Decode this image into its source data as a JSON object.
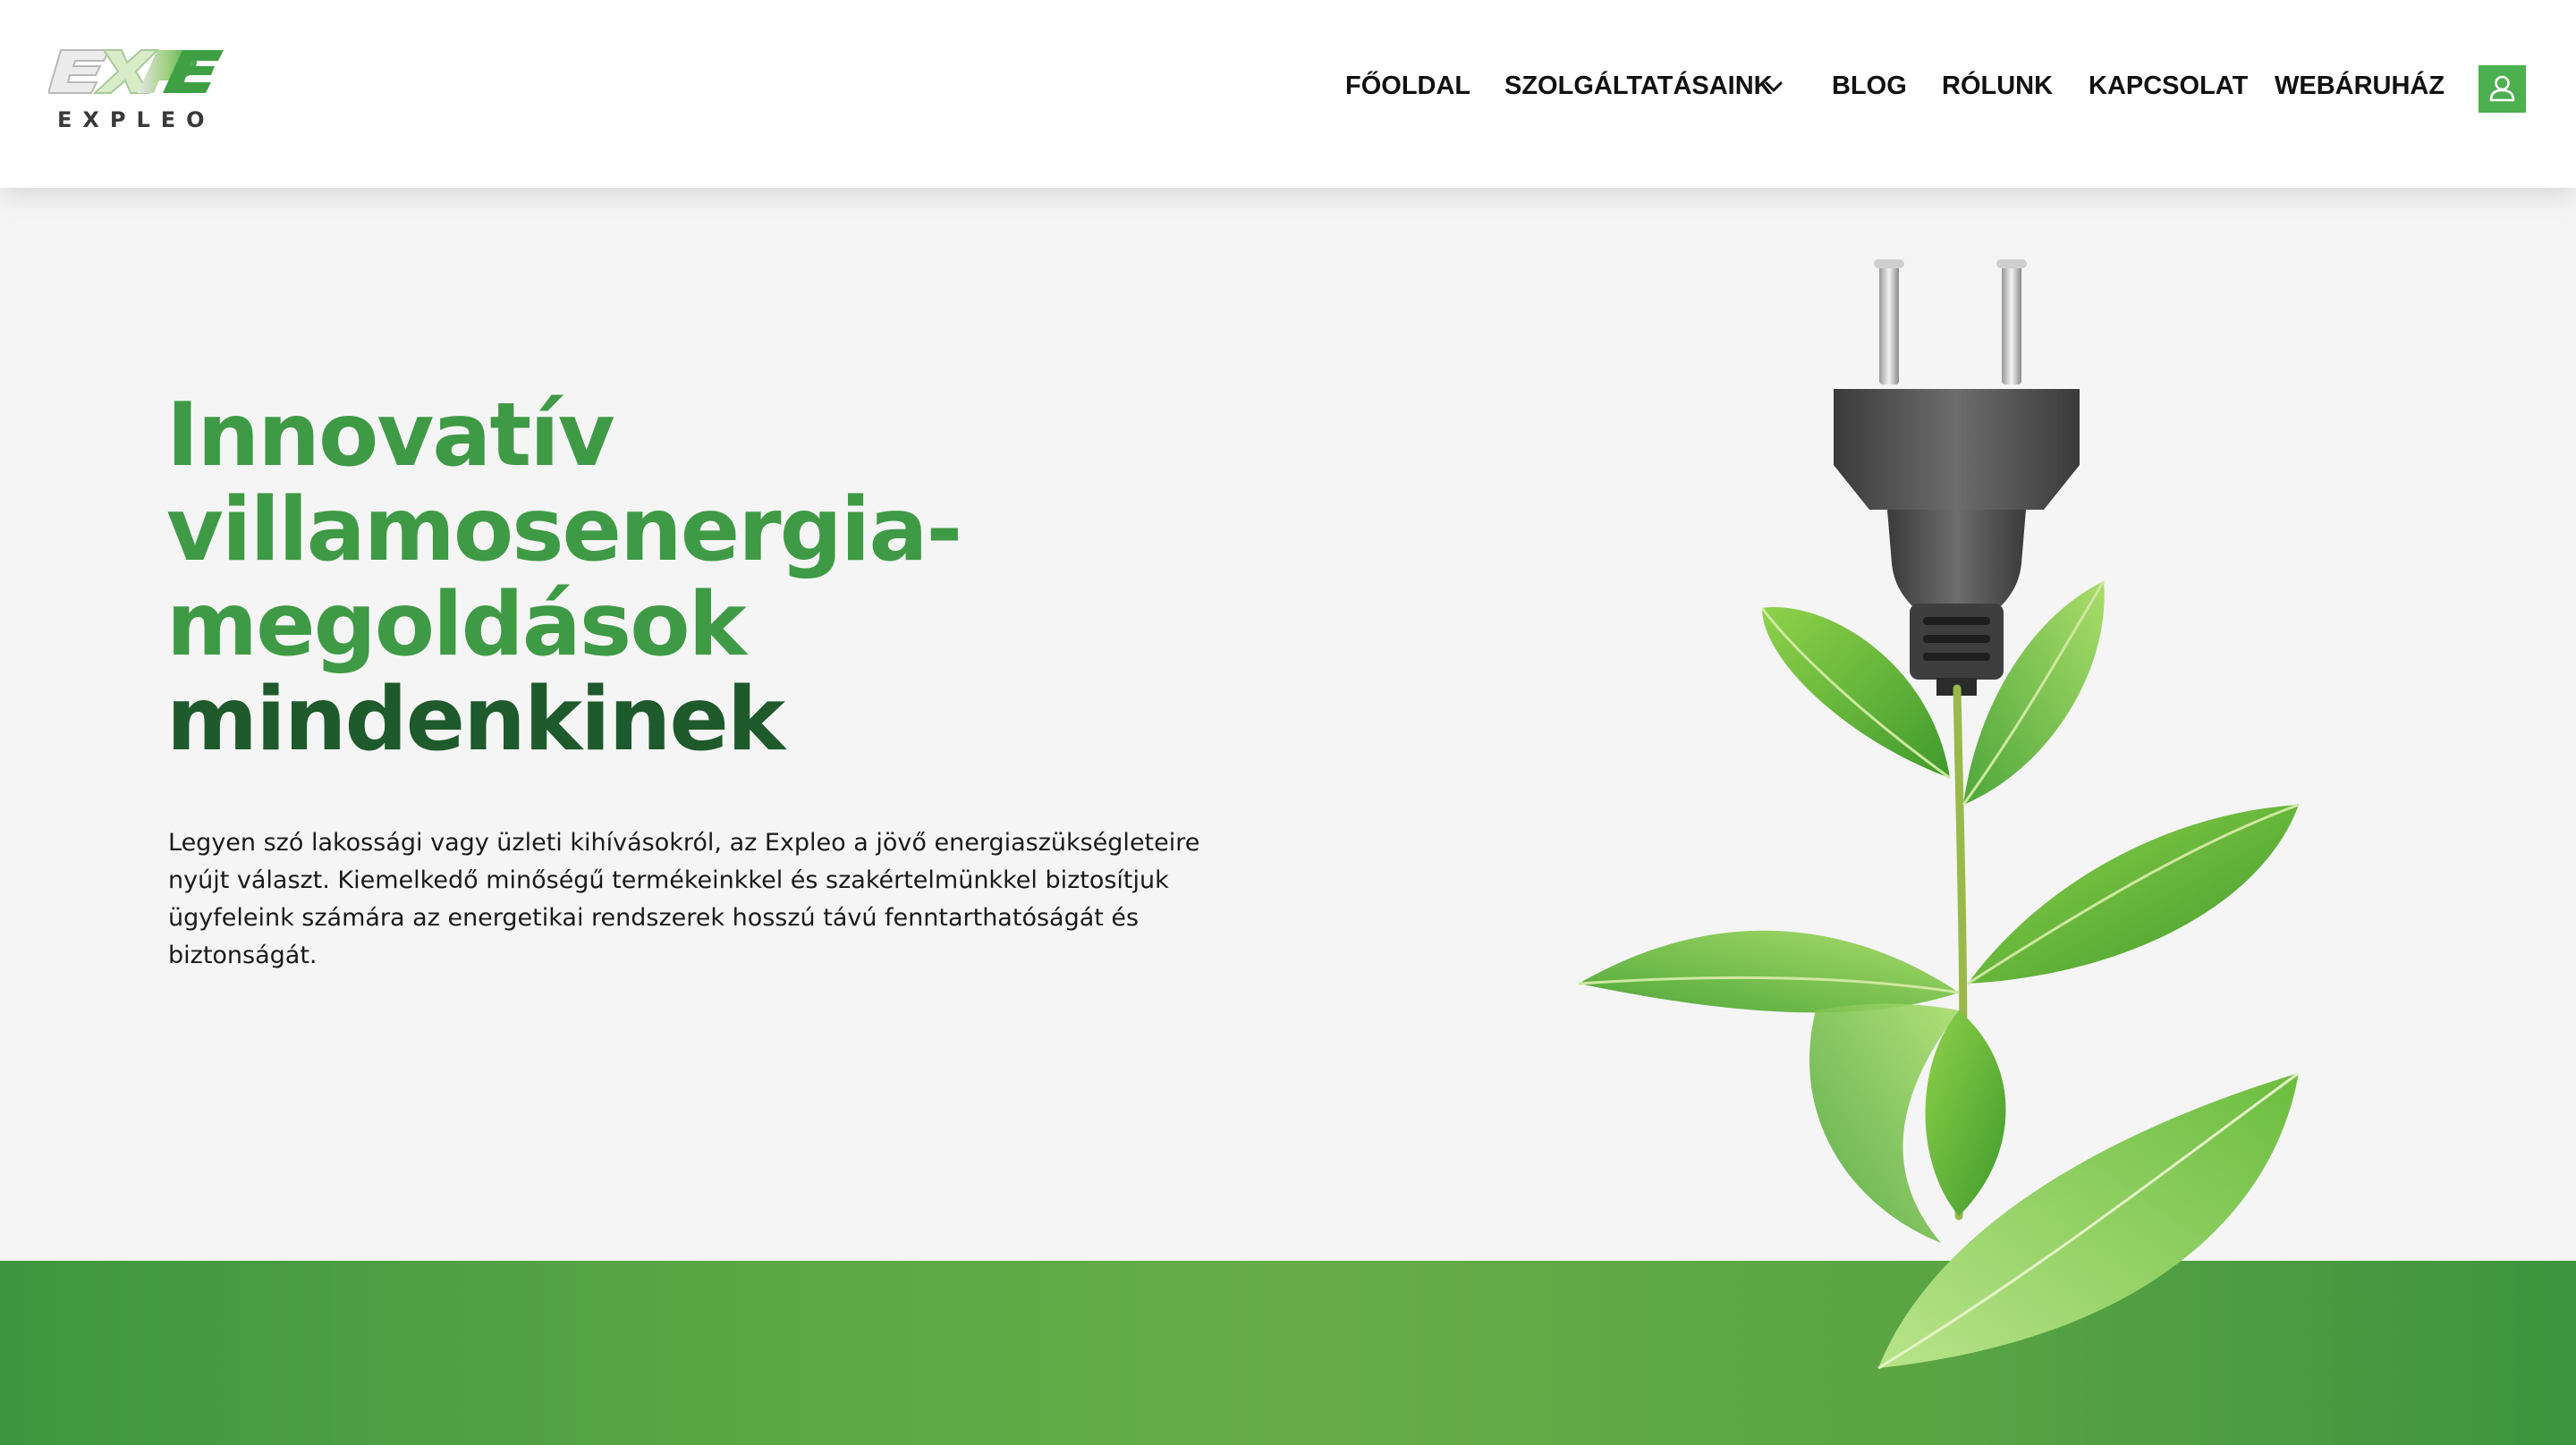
{
  "brand": {
    "name": "EXPLEO",
    "logo_mark": "EXPLEO"
  },
  "nav": {
    "items": [
      {
        "label": "FŐOLDAL"
      },
      {
        "label": "SZOLGÁLTATÁSAINK",
        "has_dropdown": true
      },
      {
        "label": "BLOG"
      },
      {
        "label": "RÓLUNK"
      },
      {
        "label": "KAPCSOLAT"
      },
      {
        "label": "WEBÁRUHÁZ"
      }
    ],
    "user_icon": "user-icon",
    "accent_color": "#4caf50"
  },
  "hero": {
    "title_lines": [
      "Innovatív",
      "villamosenergia-",
      "megoldások",
      "mindenkinek"
    ],
    "title_colors": [
      "#3f9a45",
      "#3f9a45",
      "#3f9a45",
      "#1e5a2c"
    ],
    "description": "Legyen szó lakossági vagy üzleti kihívásokról, az Expleo a jövő energiaszükségleteire nyújt választ. Kiemelkedő minőségű termékeinkkel és szakértelmünkkel biztosítjuk ügyfeleink számára az energetikai rendszerek hosszú távú fenntarthatóságát és biztonságát.",
    "image": "plug-with-green-leaves"
  },
  "colors": {
    "primary_green": "#4caf50",
    "title_green": "#3f9a45",
    "dark_green": "#1e5a2c",
    "band_green": "#5aa845",
    "background": "#f5f5f5"
  }
}
